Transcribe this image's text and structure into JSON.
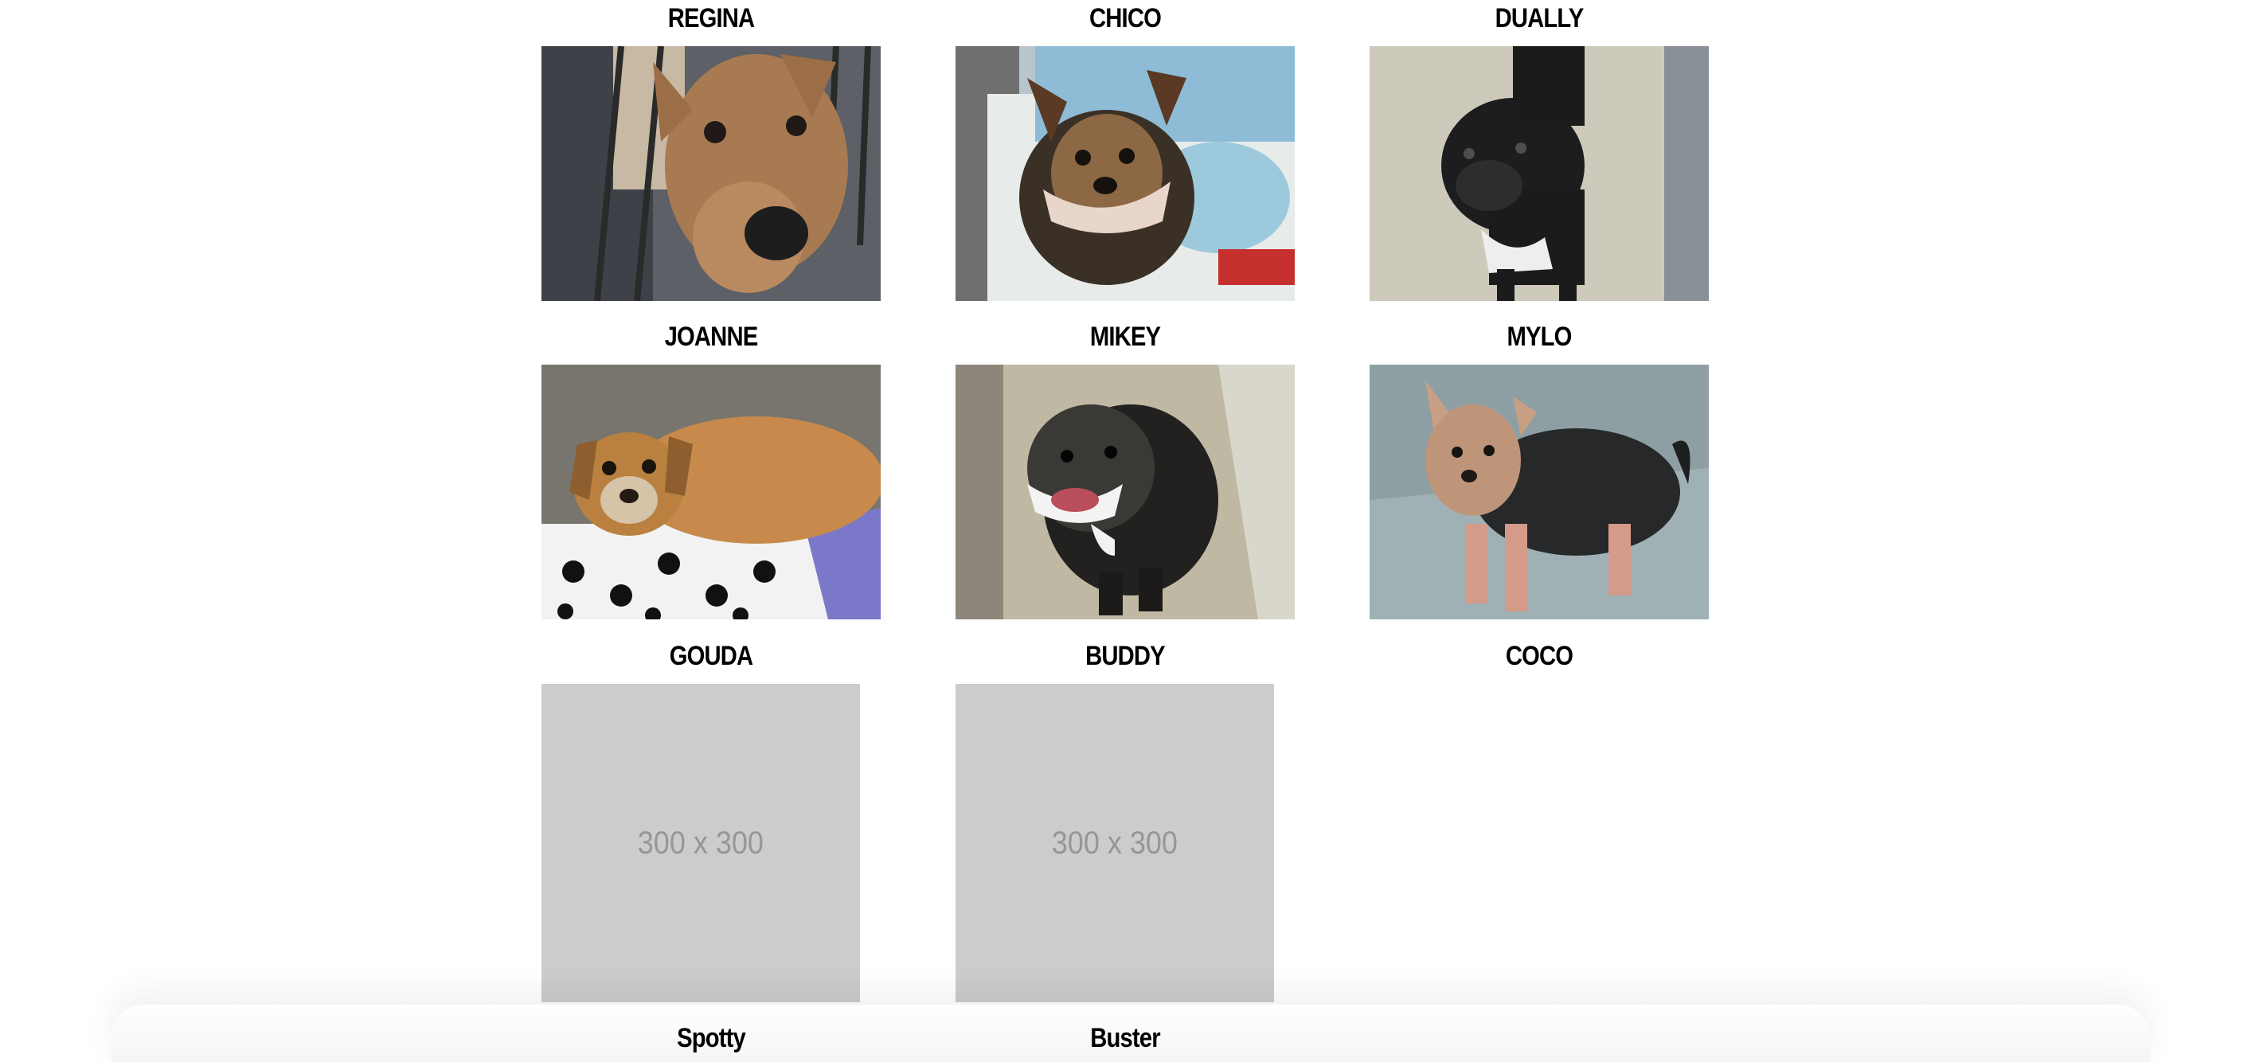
{
  "pets": [
    {
      "name": "REGINA",
      "photo": "tan-dog-photo"
    },
    {
      "name": "CHICO",
      "photo": "yorkie-photo"
    },
    {
      "name": "DUALLY",
      "photo": "black-dog-photo"
    },
    {
      "name": "JOANNE",
      "photo": "tan-dog-blanket-photo"
    },
    {
      "name": "MIKEY",
      "photo": "dark-scruffy-dog-photo"
    },
    {
      "name": "MYLO",
      "photo": "yorkie-grey-floor-photo"
    },
    {
      "name": "GOUDA",
      "placeholder": "300 x 300"
    },
    {
      "name": "BUDDY",
      "placeholder": "300 x 300"
    },
    {
      "name": "COCO"
    },
    {
      "name": "Spotty"
    },
    {
      "name": "Buster"
    }
  ]
}
